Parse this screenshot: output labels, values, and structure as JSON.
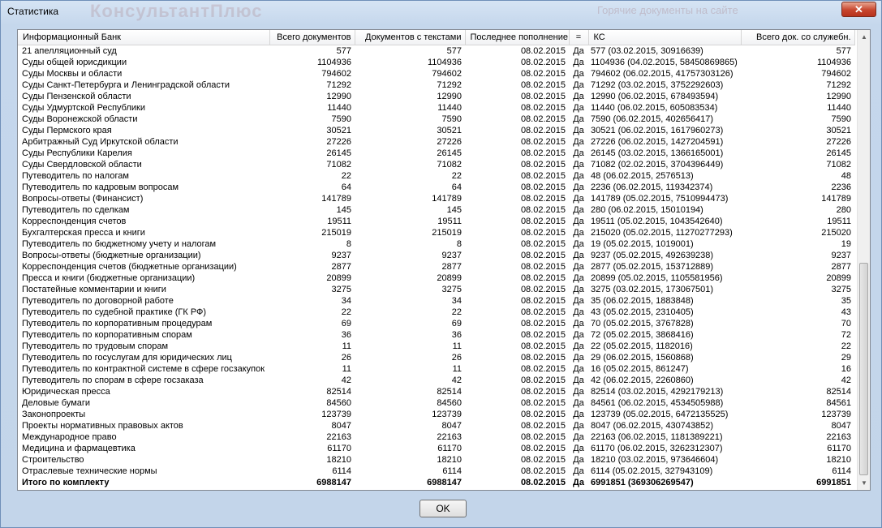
{
  "window": {
    "title": "Статистика",
    "close_label": "✕",
    "background_brand": "КонсультантПлюс",
    "background_hotdocs": "Горячие документы на сайте"
  },
  "columns": [
    "Информационный Банк",
    "Всего документов",
    "Документов с текстами",
    "Последнее пополнение",
    "=",
    "КС",
    "Всего док. со служебн."
  ],
  "rows": [
    [
      "21 апелляционный суд",
      "577",
      "577",
      "08.02.2015",
      "Да",
      "577 (03.02.2015, 30916639)",
      "577"
    ],
    [
      "Суды общей юрисдикции",
      "1104936",
      "1104936",
      "08.02.2015",
      "Да",
      "1104936 (04.02.2015, 58450869865)",
      "1104936"
    ],
    [
      "Суды Москвы и области",
      "794602",
      "794602",
      "08.02.2015",
      "Да",
      "794602 (06.02.2015, 41757303126)",
      "794602"
    ],
    [
      "Суды Санкт-Петербурга и Ленинградской области",
      "71292",
      "71292",
      "08.02.2015",
      "Да",
      "71292 (03.02.2015, 3752292603)",
      "71292"
    ],
    [
      "Суды Пензенской области",
      "12990",
      "12990",
      "08.02.2015",
      "Да",
      "12990 (06.02.2015, 678493594)",
      "12990"
    ],
    [
      "Суды Удмуртской Республики",
      "11440",
      "11440",
      "08.02.2015",
      "Да",
      "11440 (06.02.2015, 605083534)",
      "11440"
    ],
    [
      "Суды Воронежской области",
      "7590",
      "7590",
      "08.02.2015",
      "Да",
      "7590 (06.02.2015, 402656417)",
      "7590"
    ],
    [
      "Суды Пермского края",
      "30521",
      "30521",
      "08.02.2015",
      "Да",
      "30521 (06.02.2015, 1617960273)",
      "30521"
    ],
    [
      "Арбитражный Суд Иркутской области",
      "27226",
      "27226",
      "08.02.2015",
      "Да",
      "27226 (06.02.2015, 1427204591)",
      "27226"
    ],
    [
      "Суды Республики Карелия",
      "26145",
      "26145",
      "08.02.2015",
      "Да",
      "26145 (03.02.2015, 1366165001)",
      "26145"
    ],
    [
      "Суды Свердловской области",
      "71082",
      "71082",
      "08.02.2015",
      "Да",
      "71082 (02.02.2015, 3704396449)",
      "71082"
    ],
    [
      "Путеводитель по налогам",
      "22",
      "22",
      "08.02.2015",
      "Да",
      "48 (06.02.2015, 2576513)",
      "48"
    ],
    [
      "Путеводитель по кадровым вопросам",
      "64",
      "64",
      "08.02.2015",
      "Да",
      "2236 (06.02.2015, 119342374)",
      "2236"
    ],
    [
      "Вопросы-ответы (Финансист)",
      "141789",
      "141789",
      "08.02.2015",
      "Да",
      "141789 (05.02.2015, 7510994473)",
      "141789"
    ],
    [
      "Путеводитель по сделкам",
      "145",
      "145",
      "08.02.2015",
      "Да",
      "280 (06.02.2015, 15010194)",
      "280"
    ],
    [
      "Корреспонденция счетов",
      "19511",
      "19511",
      "08.02.2015",
      "Да",
      "19511 (05.02.2015, 1043542640)",
      "19511"
    ],
    [
      "Бухгалтерская пресса и книги",
      "215019",
      "215019",
      "08.02.2015",
      "Да",
      "215020 (05.02.2015, 11270277293)",
      "215020"
    ],
    [
      "Путеводитель по бюджетному учету и налогам",
      "8",
      "8",
      "08.02.2015",
      "Да",
      "19 (05.02.2015, 1019001)",
      "19"
    ],
    [
      "Вопросы-ответы (бюджетные организации)",
      "9237",
      "9237",
      "08.02.2015",
      "Да",
      "9237 (05.02.2015, 492639238)",
      "9237"
    ],
    [
      "Корреспонденция счетов (бюджетные организации)",
      "2877",
      "2877",
      "08.02.2015",
      "Да",
      "2877 (05.02.2015, 153712889)",
      "2877"
    ],
    [
      "Пресса и книги (бюджетные организации)",
      "20899",
      "20899",
      "08.02.2015",
      "Да",
      "20899 (05.02.2015, 1105581956)",
      "20899"
    ],
    [
      "Постатейные комментарии и книги",
      "3275",
      "3275",
      "08.02.2015",
      "Да",
      "3275 (03.02.2015, 173067501)",
      "3275"
    ],
    [
      "Путеводитель по договорной работе",
      "34",
      "34",
      "08.02.2015",
      "Да",
      "35 (06.02.2015, 1883848)",
      "35"
    ],
    [
      "Путеводитель по судебной практике (ГК РФ)",
      "22",
      "22",
      "08.02.2015",
      "Да",
      "43 (05.02.2015, 2310405)",
      "43"
    ],
    [
      "Путеводитель по корпоративным процедурам",
      "69",
      "69",
      "08.02.2015",
      "Да",
      "70 (05.02.2015, 3767828)",
      "70"
    ],
    [
      "Путеводитель по корпоративным спорам",
      "36",
      "36",
      "08.02.2015",
      "Да",
      "72 (05.02.2015, 3868416)",
      "72"
    ],
    [
      "Путеводитель по трудовым спорам",
      "11",
      "11",
      "08.02.2015",
      "Да",
      "22 (05.02.2015, 1182016)",
      "22"
    ],
    [
      "Путеводитель по госуслугам для юридических лиц",
      "26",
      "26",
      "08.02.2015",
      "Да",
      "29 (06.02.2015, 1560868)",
      "29"
    ],
    [
      "Путеводитель по контрактной системе в сфере госзакупок",
      "11",
      "11",
      "08.02.2015",
      "Да",
      "16 (05.02.2015, 861247)",
      "16"
    ],
    [
      "Путеводитель по спорам в сфере госзаказа",
      "42",
      "42",
      "08.02.2015",
      "Да",
      "42 (06.02.2015, 2260860)",
      "42"
    ],
    [
      "Юридическая пресса",
      "82514",
      "82514",
      "08.02.2015",
      "Да",
      "82514 (03.02.2015, 4292179213)",
      "82514"
    ],
    [
      "Деловые бумаги",
      "84560",
      "84560",
      "08.02.2015",
      "Да",
      "84561 (06.02.2015, 4534505988)",
      "84561"
    ],
    [
      "Законопроекты",
      "123739",
      "123739",
      "08.02.2015",
      "Да",
      "123739 (05.02.2015, 6472135525)",
      "123739"
    ],
    [
      "Проекты нормативных правовых актов",
      "8047",
      "8047",
      "08.02.2015",
      "Да",
      "8047 (06.02.2015, 430743852)",
      "8047"
    ],
    [
      "Международное право",
      "22163",
      "22163",
      "08.02.2015",
      "Да",
      "22163 (06.02.2015, 1181389221)",
      "22163"
    ],
    [
      "Медицина и фармацевтика",
      "61170",
      "61170",
      "08.02.2015",
      "Да",
      "61170 (06.02.2015, 3262312307)",
      "61170"
    ],
    [
      "Строительство",
      "18210",
      "18210",
      "08.02.2015",
      "Да",
      "18210 (03.02.2015, 973646604)",
      "18210"
    ],
    [
      "Отраслевые технические нормы",
      "6114",
      "6114",
      "08.02.2015",
      "Да",
      "6114 (05.02.2015, 327943109)",
      "6114"
    ]
  ],
  "total": [
    "Итого по комплекту",
    "6988147",
    "6988147",
    "08.02.2015",
    "Да",
    "6991851 (369306269547)",
    "6991851"
  ],
  "ok_label": "OK"
}
